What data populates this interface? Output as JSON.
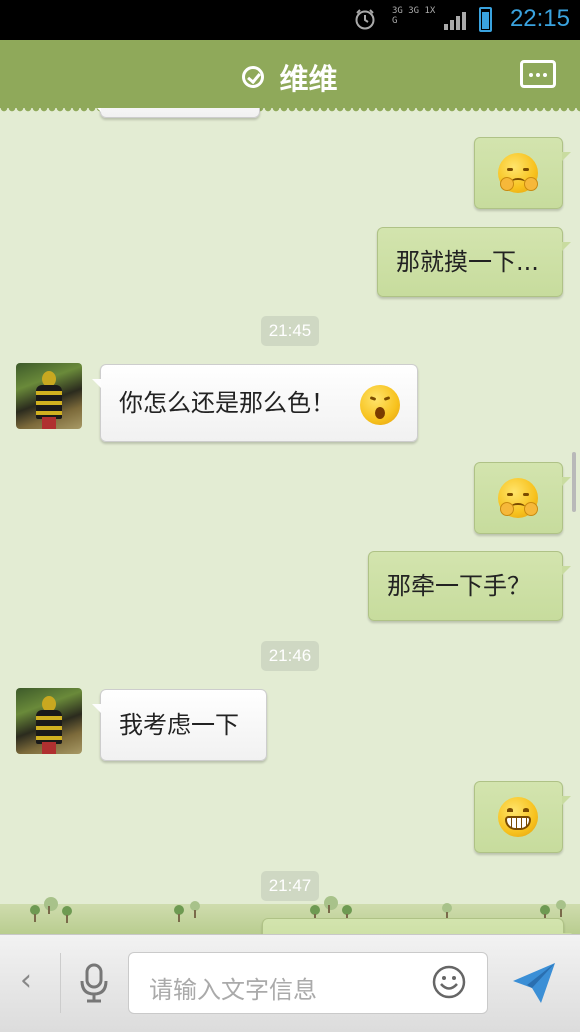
{
  "status_bar": {
    "time": "22:15",
    "network_text": "3G 3G 1X G",
    "icons": [
      "alarm-icon",
      "network-icon",
      "signal-icon",
      "battery-icon"
    ]
  },
  "header": {
    "title": "维维",
    "verified_icon": "check-circle-icon",
    "menu_icon": "more-icon",
    "bg_color": "#8fa95a"
  },
  "messages": [
    {
      "side": "right",
      "type": "emoji",
      "emoji": "shy-face"
    },
    {
      "side": "right",
      "type": "text",
      "text": "那就摸一下..."
    },
    {
      "type": "time",
      "text": "21:45"
    },
    {
      "side": "left",
      "type": "text",
      "text": "你怎么还是那么色！",
      "emoji": "surprised-face"
    },
    {
      "side": "right",
      "type": "emoji",
      "emoji": "shy-face"
    },
    {
      "side": "right",
      "type": "text",
      "text": "那牵一下手？"
    },
    {
      "type": "time",
      "text": "21:46"
    },
    {
      "side": "left",
      "type": "text",
      "text": "我考虑一下"
    },
    {
      "side": "right",
      "type": "emoji",
      "emoji": "grin-face"
    },
    {
      "type": "time",
      "text": "21:47"
    }
  ],
  "input_bar": {
    "placeholder": "请输入文字信息",
    "icons": [
      "back-icon",
      "microphone-icon",
      "smiley-icon",
      "send-icon"
    ]
  },
  "colors": {
    "background": "#e3ecd3",
    "outgoing_bubble": "#cbdca2",
    "incoming_bubble": "#ffffff",
    "time_color": "#3aa3df"
  }
}
